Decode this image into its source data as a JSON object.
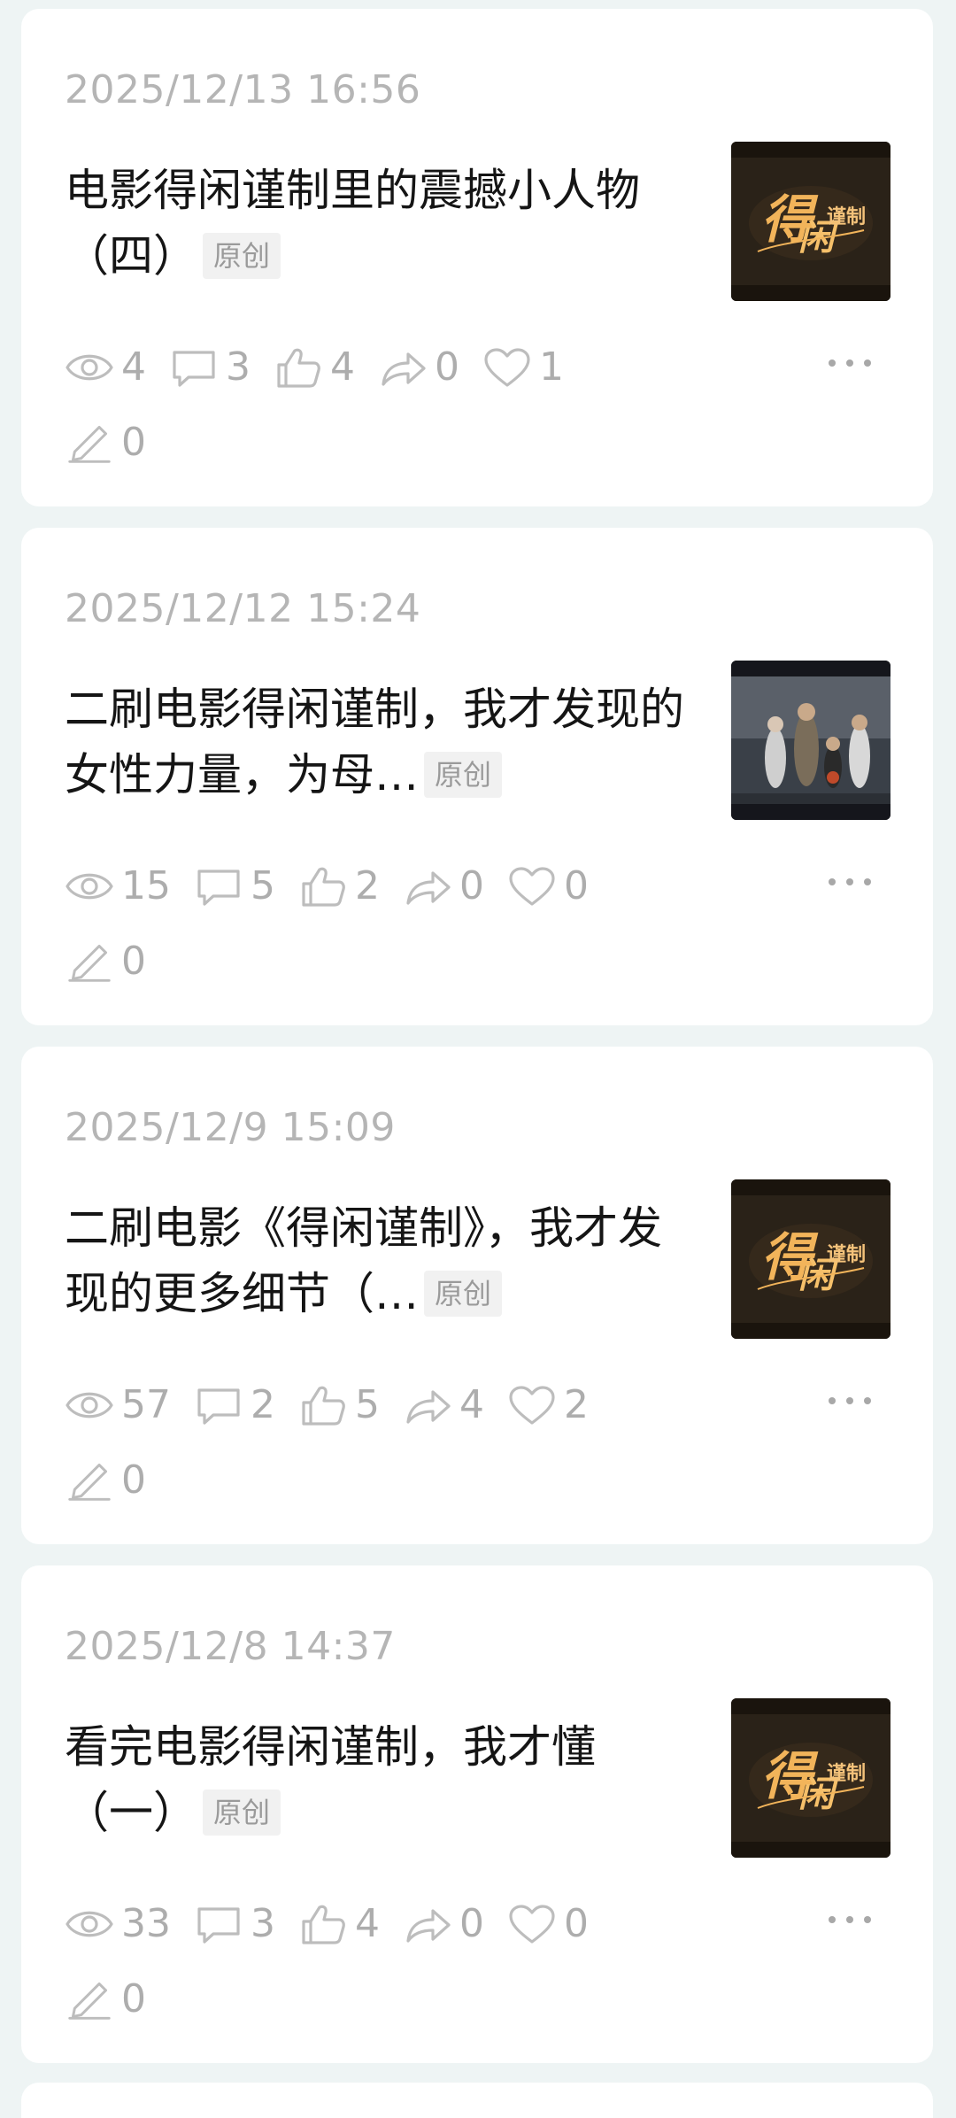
{
  "posts": [
    {
      "time": "2025/12/13 16:56",
      "title": "电影得闲谨制里的震撼小人物（四）",
      "badge": "原创",
      "thumbnail": "film-logo-thumbnail",
      "views": "4",
      "comments": "3",
      "likes": "4",
      "shares": "0",
      "favorites": "1",
      "edits": "0"
    },
    {
      "time": "2025/12/12 15:24",
      "title": "二刷电影得闲谨制，我才发现的女性力量，为母…",
      "badge": "原创",
      "thumbnail": "family-still-thumbnail",
      "views": "15",
      "comments": "5",
      "likes": "2",
      "shares": "0",
      "favorites": "0",
      "edits": "0"
    },
    {
      "time": "2025/12/9 15:09",
      "title": "二刷电影《得闲谨制》，我才发现的更多细节（…",
      "badge": "原创",
      "thumbnail": "film-logo-thumbnail",
      "views": "57",
      "comments": "2",
      "likes": "5",
      "shares": "4",
      "favorites": "2",
      "edits": "0"
    },
    {
      "time": "2025/12/8 14:37",
      "title": "看完电影得闲谨制，我才懂（一）",
      "badge": "原创",
      "thumbnail": "film-logo-thumbnail",
      "views": "33",
      "comments": "3",
      "likes": "4",
      "shares": "0",
      "favorites": "0",
      "edits": "0"
    }
  ],
  "colors": {
    "background": "#eef4f4",
    "card": "#ffffff",
    "muted_text": "#b5b5b5",
    "icon": "#bdbdbd",
    "badge_bg": "#f1f1f1",
    "logo_gold": "#f2b45a"
  }
}
